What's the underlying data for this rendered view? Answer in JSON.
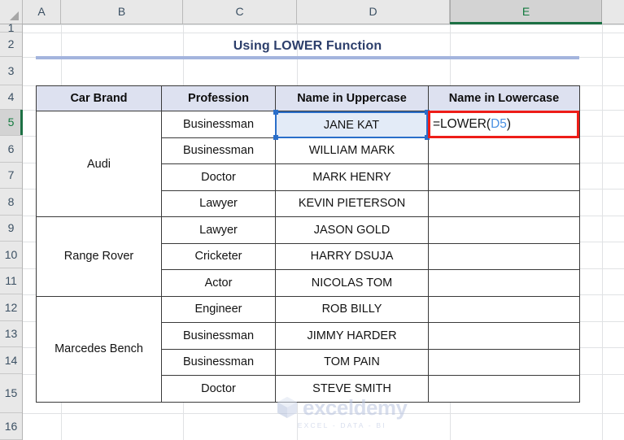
{
  "app": {
    "type": "spreadsheet",
    "accent_selection_green": "#1d7044",
    "reference_blue": "#2a6ec9",
    "highlight_red": "#ee1d18",
    "header_fill": "#dde1f0",
    "title_color": "#2c3e6b",
    "rule_color": "#a3b4dd"
  },
  "grid": {
    "corner_icon": "select-all-triangle-icon",
    "columns": [
      {
        "letter": "A",
        "selected": false
      },
      {
        "letter": "B",
        "selected": false
      },
      {
        "letter": "C",
        "selected": false
      },
      {
        "letter": "D",
        "selected": false
      },
      {
        "letter": "E",
        "selected": true
      }
    ],
    "rows": [
      "1",
      "2",
      "3",
      "4",
      "5",
      "6",
      "7",
      "8",
      "9",
      "10",
      "11",
      "12",
      "13",
      "14",
      "15",
      "16"
    ],
    "selected_row": "5",
    "active_cell": "E5"
  },
  "title": {
    "text": "Using LOWER Function"
  },
  "table": {
    "headers": [
      "Car Brand",
      "Profession",
      "Name in Uppercase",
      "Name in Lowercase"
    ],
    "rows": [
      {
        "brand": "Audi",
        "brand_span": 4,
        "profession": "Businessman",
        "uppercase": "JANE KAT",
        "lowercase": ""
      },
      {
        "brand": null,
        "brand_span": 0,
        "profession": "Businessman",
        "uppercase": "WILLIAM MARK",
        "lowercase": ""
      },
      {
        "brand": null,
        "brand_span": 0,
        "profession": "Doctor",
        "uppercase": "MARK HENRY",
        "lowercase": ""
      },
      {
        "brand": null,
        "brand_span": 0,
        "profession": "Lawyer",
        "uppercase": "KEVIN PIETERSON",
        "lowercase": ""
      },
      {
        "brand": "Range Rover",
        "brand_span": 3,
        "profession": "Lawyer",
        "uppercase": "JASON GOLD",
        "lowercase": ""
      },
      {
        "brand": null,
        "brand_span": 0,
        "profession": "Cricketer",
        "uppercase": "HARRY DSUJA",
        "lowercase": ""
      },
      {
        "brand": null,
        "brand_span": 0,
        "profession": "Actor",
        "uppercase": "NICOLAS TOM",
        "lowercase": ""
      },
      {
        "brand": "Marcedes Bench",
        "brand_span": 4,
        "profession": "Engineer",
        "uppercase": "ROB BILLY",
        "lowercase": ""
      },
      {
        "brand": null,
        "brand_span": 0,
        "profession": "Businessman",
        "uppercase": "JIMMY HARDER",
        "lowercase": ""
      },
      {
        "brand": null,
        "brand_span": 0,
        "profession": "Businessman",
        "uppercase": "TOM PAIN",
        "lowercase": ""
      },
      {
        "brand": null,
        "brand_span": 0,
        "profession": "Doctor",
        "uppercase": "STEVE SMITH",
        "lowercase": ""
      }
    ]
  },
  "selection": {
    "referenced_cell_text": "JANE KAT",
    "referenced_cell_address": "D5"
  },
  "formula_edit": {
    "prefix": "=LOWER(",
    "reference": "D5",
    "suffix": ")",
    "full": "=LOWER(D5)"
  },
  "watermark": {
    "word": "exceldemy",
    "tagline": "EXCEL  -  DATA  -  BI"
  }
}
